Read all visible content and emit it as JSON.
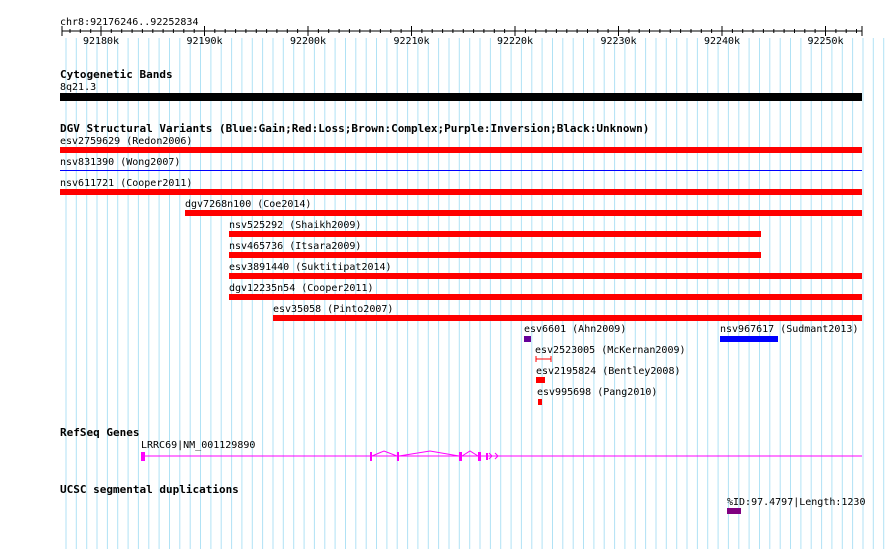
{
  "ruler": {
    "range_label": "chr8:92176246..92252834",
    "ticks": [
      "92180k",
      "92190k",
      "92200k",
      "92210k",
      "92220k",
      "92230k",
      "92240k",
      "92250k"
    ]
  },
  "cytoband": {
    "title": "Cytogenetic Bands",
    "band_label": "8q21.3",
    "color": "#000000"
  },
  "dgv": {
    "title": "DGV Structural Variants (Blue:Gain;Red:Loss;Brown:Complex;Purple:Inversion;Black:Unknown)",
    "colors": {
      "gain": "#0000ff",
      "loss": "#ff0000",
      "inversion": "#660099"
    },
    "features": [
      {
        "label": "esv2759629 (Redon2006)",
        "type": "loss"
      },
      {
        "label": "nsv831390 (Wong2007)",
        "type": "gain"
      },
      {
        "label": "nsv611721 (Cooper2011)",
        "type": "loss"
      },
      {
        "label": "dgv7268n100 (Coe2014)",
        "type": "loss"
      },
      {
        "label": "nsv525292 (Shaikh2009)",
        "type": "loss"
      },
      {
        "label": "nsv465736 (Itsara2009)",
        "type": "loss"
      },
      {
        "label": "esv3891440 (Suktitipat2014)",
        "type": "loss"
      },
      {
        "label": "dgv12235n54 (Cooper2011)",
        "type": "loss"
      },
      {
        "label": "esv35058 (Pinto2007)",
        "type": "loss"
      },
      {
        "label": "esv6601 (Ahn2009)",
        "type": "inversion"
      },
      {
        "label": "nsv967617 (Sudmant2013)",
        "type": "gain"
      },
      {
        "label": "esv2523005 (McKernan2009)",
        "type": "loss"
      },
      {
        "label": "esv2195824 (Bentley2008)",
        "type": "loss"
      },
      {
        "label": "esv995698 (Pang2010)",
        "type": "loss"
      }
    ]
  },
  "refseq": {
    "title": "RefSeq Genes",
    "gene_label": "LRRC69|NM_001129890",
    "color": "#ff00ff"
  },
  "segdup": {
    "title": "UCSC segmental duplications",
    "feature_label": "%ID:97.4797|Length:1230",
    "color": "#800080"
  }
}
